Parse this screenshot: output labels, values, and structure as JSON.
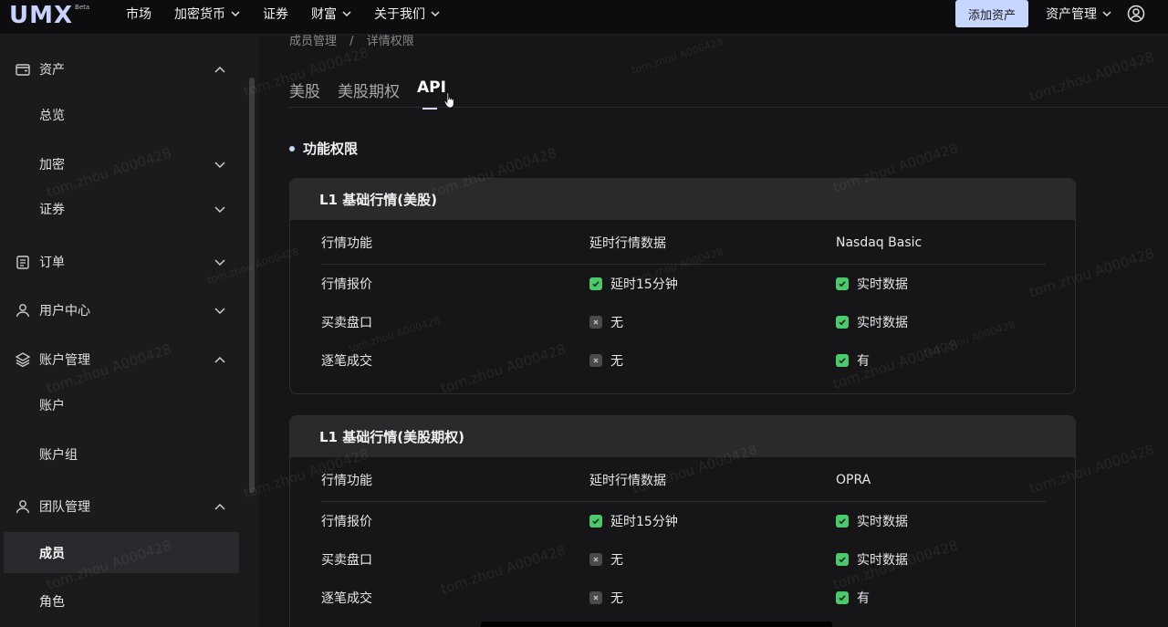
{
  "header": {
    "logo": "UMX",
    "logo_badge": "Beta",
    "nav": [
      "市场",
      "加密货币",
      "证券",
      "财富",
      "关于我们"
    ],
    "add_asset": "添加资产",
    "asset_mgmt": "资产管理"
  },
  "sidebar": {
    "items": [
      {
        "label": "资产",
        "icon": "wallet-icon"
      },
      {
        "label": "总览"
      },
      {
        "label": "加密"
      },
      {
        "label": "证券"
      },
      {
        "label": "订单",
        "icon": "clipboard-icon"
      },
      {
        "label": "用户中心",
        "icon": "user-icon"
      },
      {
        "label": "账户管理",
        "icon": "layers-icon"
      },
      {
        "label": "账户"
      },
      {
        "label": "账户组"
      },
      {
        "label": "团队管理",
        "icon": "team-icon"
      },
      {
        "label": "成员"
      },
      {
        "label": "角色"
      }
    ]
  },
  "main": {
    "breadcrumb": [
      "成员管理",
      "/",
      "详情权限"
    ],
    "tabs": [
      "美股",
      "美股期权",
      "API"
    ],
    "active_tab": "API",
    "section_title": "功能权限",
    "cards": [
      {
        "title": "L1 基础行情(美股)",
        "columns": [
          "行情功能",
          "延时行情数据",
          "Nasdaq Basic"
        ],
        "rows": [
          {
            "feature": "行情报价",
            "delayed": "延时15分钟",
            "delayed_ok": true,
            "premium": "实时数据",
            "premium_ok": true
          },
          {
            "feature": "买卖盘口",
            "delayed": "无",
            "delayed_ok": false,
            "premium": "实时数据",
            "premium_ok": true
          },
          {
            "feature": "逐笔成交",
            "delayed": "无",
            "delayed_ok": false,
            "premium": "有",
            "premium_ok": true
          }
        ]
      },
      {
        "title": "L1 基础行情(美股期权)",
        "columns": [
          "行情功能",
          "延时行情数据",
          "OPRA"
        ],
        "rows": [
          {
            "feature": "行情报价",
            "delayed": "延时15分钟",
            "delayed_ok": true,
            "premium": "实时数据",
            "premium_ok": true
          },
          {
            "feature": "买卖盘口",
            "delayed": "无",
            "delayed_ok": false,
            "premium": "实时数据",
            "premium_ok": true
          },
          {
            "feature": "逐笔成交",
            "delayed": "无",
            "delayed_ok": false,
            "premium": "有",
            "premium_ok": true
          }
        ]
      }
    ]
  },
  "watermark": "tom.zhou A000428",
  "colors": {
    "accent": "#c7d6ff",
    "check_green": "#4cc96a",
    "check_gray": "#4a4a4e"
  }
}
